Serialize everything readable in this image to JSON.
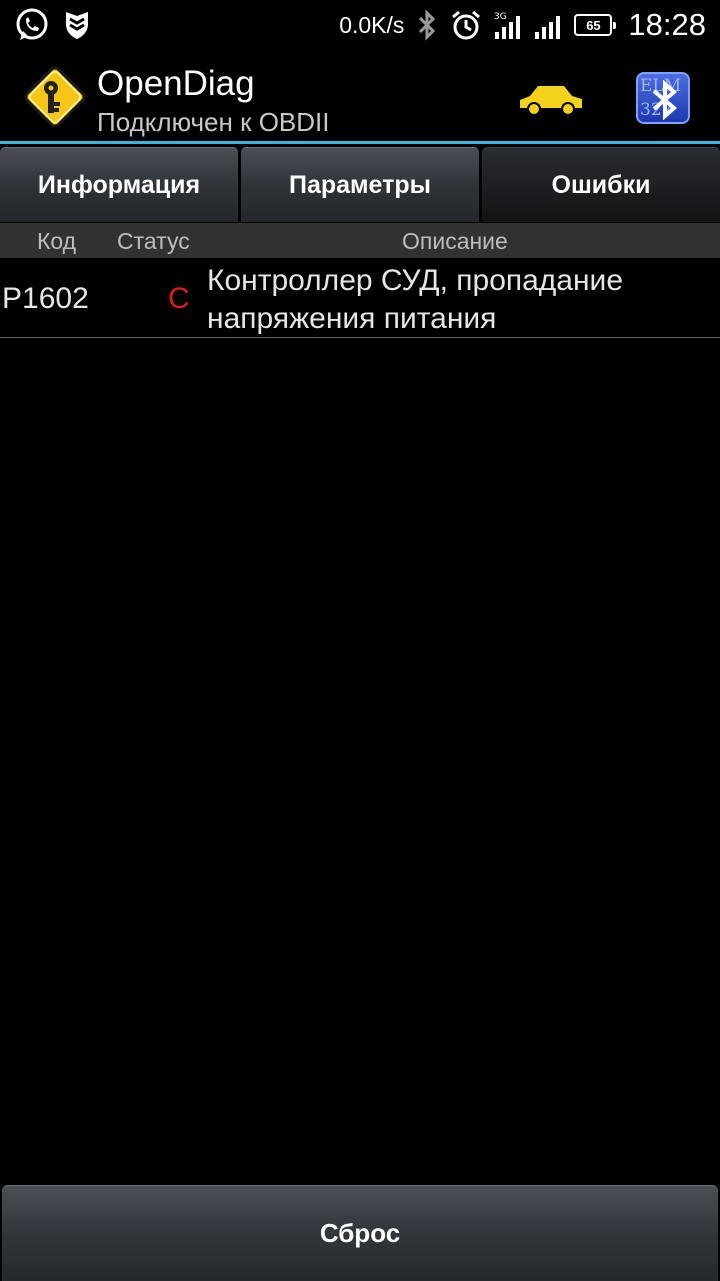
{
  "status_bar": {
    "net_speed": "0.0K/s",
    "network_type": "3G",
    "battery": "65",
    "time": "18:28"
  },
  "action_bar": {
    "title": "OpenDiag",
    "subtitle": "Подключен к OBDII",
    "car_color": "#f3d21a",
    "bt_button_text": "ELM 327"
  },
  "tabs": [
    {
      "label": "Информация",
      "active": false
    },
    {
      "label": "Параметры",
      "active": false
    },
    {
      "label": "Ошибки",
      "active": true
    }
  ],
  "table": {
    "headers": {
      "code": "Код",
      "status": "Статус",
      "description": "Описание"
    },
    "rows": [
      {
        "code": "P1602",
        "status": "С",
        "description": "Контроллер СУД, пропадание напряжения питания"
      }
    ]
  },
  "reset_button": {
    "label": "Сброс"
  },
  "colors": {
    "accent": "#33b5e5",
    "status_error": "#e21a1a"
  }
}
